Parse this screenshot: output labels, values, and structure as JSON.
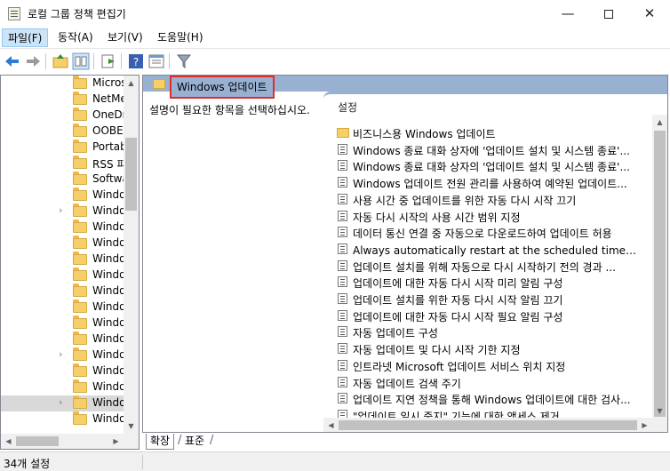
{
  "window": {
    "title": "로컬 그룹 정책 편집기",
    "minimize_glyph": "—",
    "close_glyph": "✕"
  },
  "menu": {
    "items": [
      {
        "label": "파일(F)"
      },
      {
        "label": "동작(A)"
      },
      {
        "label": "보기(V)"
      },
      {
        "label": "도움말(H)"
      }
    ]
  },
  "toolbar": {
    "icons": [
      "back-arrow-icon",
      "forward-arrow-icon",
      "up-folder-icon",
      "show-hide-tree-icon",
      "export-list-icon",
      "help-icon",
      "properties-icon",
      "filter-icon"
    ]
  },
  "tree": {
    "items": [
      {
        "label": "Micros",
        "caret": ""
      },
      {
        "label": "NetMe",
        "caret": ""
      },
      {
        "label": "OneDr",
        "caret": ""
      },
      {
        "label": "OOBE",
        "caret": ""
      },
      {
        "label": "Portab",
        "caret": ""
      },
      {
        "label": "RSS 피",
        "caret": ""
      },
      {
        "label": "Softwa",
        "caret": ""
      },
      {
        "label": "Windo",
        "caret": ""
      },
      {
        "label": "Windo",
        "caret": "›"
      },
      {
        "label": "Windo",
        "caret": ""
      },
      {
        "label": "Windo",
        "caret": ""
      },
      {
        "label": "Windo",
        "caret": ""
      },
      {
        "label": "Windo",
        "caret": ""
      },
      {
        "label": "Windo",
        "caret": ""
      },
      {
        "label": "Windo",
        "caret": ""
      },
      {
        "label": "Windo",
        "caret": ""
      },
      {
        "label": "Windo",
        "caret": ""
      },
      {
        "label": "Windo",
        "caret": "›"
      },
      {
        "label": "Windo",
        "caret": ""
      },
      {
        "label": "Windo",
        "caret": ""
      },
      {
        "label": "Windo",
        "caret": "›",
        "selected": true
      },
      {
        "label": "Windo",
        "caret": ""
      }
    ]
  },
  "detail": {
    "header_title": "Windows 업데이트",
    "description": "설명이 필요한 항목을 선택하십시오.",
    "column_header": "설정",
    "settings": [
      {
        "label": "비즈니스용 Windows 업데이트",
        "type": "folder"
      },
      {
        "label": "Windows 종료 대화 상자에 '업데이트 설치 및 시스템 종료'...",
        "type": "setting"
      },
      {
        "label": "Windows 종료 대화 상자의 '업데이트 설치 및 시스템 종료'...",
        "type": "setting"
      },
      {
        "label": "Windows 업데이트 전원 관리를 사용하여 예약된 업데이트...",
        "type": "setting"
      },
      {
        "label": "사용 시간 중 업데이트를 위한 자동 다시 시작 끄기",
        "type": "setting"
      },
      {
        "label": "자동 다시 시작의 사용 시간 범위 지정",
        "type": "setting"
      },
      {
        "label": "데이터 통신 연결 중 자동으로 다운로드하여 업데이트 허용",
        "type": "setting"
      },
      {
        "label": "Always automatically restart at the scheduled time(항상 예...",
        "type": "setting"
      },
      {
        "label": "업데이트 설치를 위해 자동으로 다시 시작하기 전의 경과 ...",
        "type": "setting"
      },
      {
        "label": "업데이트에 대한 자동 다시 시작 미리 알림 구성",
        "type": "setting"
      },
      {
        "label": "업데이트 설치를 위한 자동 다시 시작 알림 끄기",
        "type": "setting"
      },
      {
        "label": "업데이트에 대한 자동 다시 시작 필요 알림 구성",
        "type": "setting"
      },
      {
        "label": "자동 업데이트 구성",
        "type": "setting"
      },
      {
        "label": "자동 업데이트 및 다시 시작 기한 지정",
        "type": "setting"
      },
      {
        "label": "인트라넷 Microsoft 업데이트 서비스 위치 지정",
        "type": "setting"
      },
      {
        "label": "자동 업데이트 검색 주기",
        "type": "setting"
      },
      {
        "label": "업데이트 지연 정책을 통해 Windows 업데이트에 대한 검사...",
        "type": "setting"
      },
      {
        "label": "\"업데이트 일시 중지\" 기능에 대한 액세스 제거",
        "type": "setting"
      }
    ]
  },
  "tabs": {
    "expanded": "확장",
    "standard": "표준"
  },
  "status": {
    "text": "34개 설정"
  },
  "colors": {
    "header_bar": "#98b1d1",
    "highlight_border": "#e12b2b",
    "folder": "#f5cf6a",
    "menu_active": "#cce4f7"
  }
}
